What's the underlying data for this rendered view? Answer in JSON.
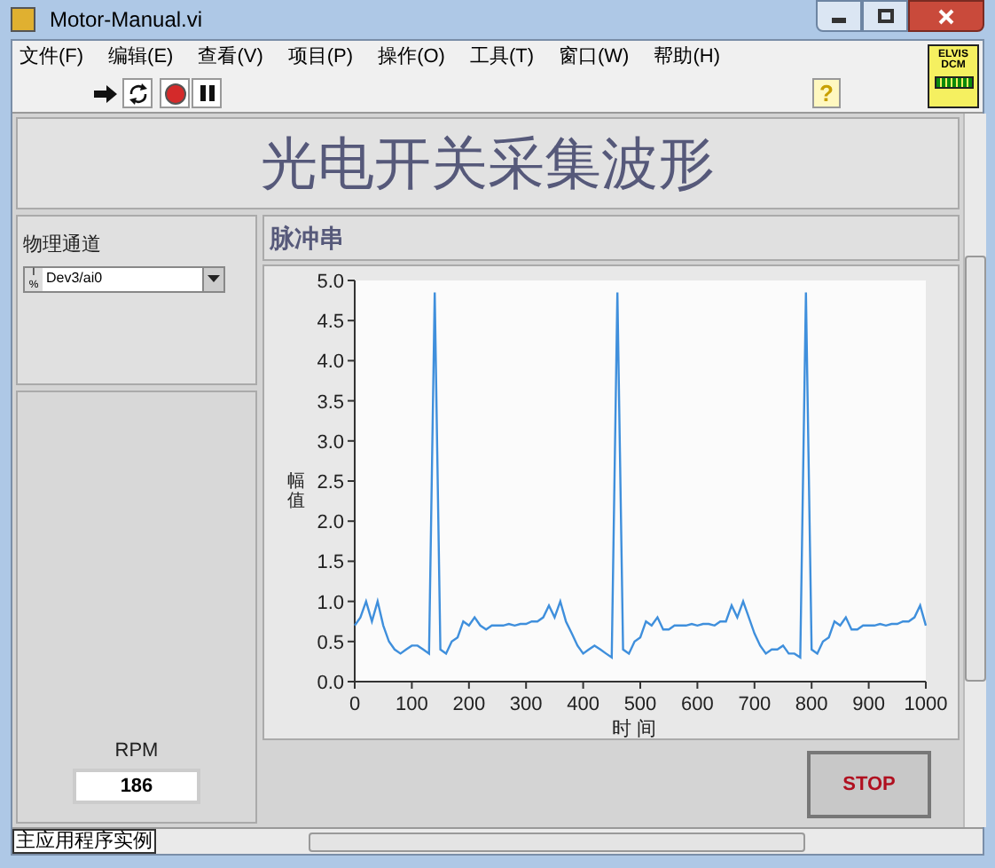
{
  "window": {
    "title": "Motor-Manual.vi"
  },
  "menu": [
    "文件(F)",
    "编辑(E)",
    "查看(V)",
    "项目(P)",
    "操作(O)",
    "工具(T)",
    "窗口(W)",
    "帮助(H)"
  ],
  "toolbar": {
    "help": "?"
  },
  "badge": {
    "line_1": "ELVIS",
    "line_2": "DCM"
  },
  "panel": {
    "title": "光电开关采集波形",
    "channel": {
      "label": "物理通道",
      "value": "Dev3/ai0",
      "prefix_1": "I",
      "prefix_2": "%"
    },
    "rpm": {
      "label": "RPM",
      "value": "186"
    },
    "graph": {
      "title": "脉冲串",
      "chart_data": {
        "type": "line",
        "xlabel": "时 间",
        "ylabel": "幅值",
        "xlim": [
          0,
          1000
        ],
        "ylim": [
          0,
          5
        ],
        "xticks": [
          0,
          100,
          200,
          300,
          400,
          500,
          600,
          700,
          800,
          900,
          1000
        ],
        "yticks": [
          {
            "value": 0,
            "label": "0.0"
          },
          {
            "value": 0.5,
            "label": "0.5"
          },
          {
            "value": 1,
            "label": "1.0"
          },
          {
            "value": 1.5,
            "label": "1.5"
          },
          {
            "value": 2,
            "label": "2.0"
          },
          {
            "value": 2.5,
            "label": "2.5"
          },
          {
            "value": 3,
            "label": "3.0"
          },
          {
            "value": 3.5,
            "label": "3.5"
          },
          {
            "value": 4,
            "label": "4.0"
          },
          {
            "value": 4.5,
            "label": "4.5"
          },
          {
            "value": 5,
            "label": "5.0"
          }
        ],
        "x": [
          0,
          10,
          20,
          30,
          40,
          50,
          60,
          70,
          80,
          90,
          100,
          110,
          120,
          130,
          140,
          150,
          160,
          170,
          180,
          190,
          200,
          210,
          220,
          230,
          240,
          250,
          260,
          270,
          280,
          290,
          300,
          310,
          320,
          330,
          340,
          350,
          360,
          370,
          380,
          390,
          400,
          410,
          420,
          430,
          440,
          450,
          460,
          470,
          480,
          490,
          500,
          510,
          520,
          530,
          540,
          550,
          560,
          570,
          580,
          590,
          600,
          610,
          620,
          630,
          640,
          650,
          660,
          670,
          680,
          690,
          700,
          710,
          720,
          730,
          740,
          750,
          760,
          770,
          780,
          790,
          800,
          810,
          820,
          830,
          840,
          850,
          860,
          870,
          880,
          890,
          900,
          910,
          920,
          930,
          940,
          950,
          960,
          970,
          980,
          990,
          1000
        ],
        "series": [
          {
            "color": "#3f8fdc",
            "values": [
              0.7,
              0.8,
              1.0,
              0.75,
              1.0,
              0.7,
              0.5,
              0.4,
              0.35,
              0.4,
              0.45,
              0.45,
              0.4,
              0.35,
              4.85,
              0.4,
              0.35,
              0.5,
              0.55,
              0.75,
              0.7,
              0.8,
              0.7,
              0.65,
              0.7,
              0.7,
              0.7,
              0.72,
              0.7,
              0.72,
              0.72,
              0.75,
              0.75,
              0.8,
              0.95,
              0.8,
              1.0,
              0.75,
              0.6,
              0.45,
              0.35,
              0.4,
              0.45,
              0.4,
              0.35,
              0.3,
              4.85,
              0.4,
              0.35,
              0.5,
              0.55,
              0.75,
              0.7,
              0.8,
              0.65,
              0.65,
              0.7,
              0.7,
              0.7,
              0.72,
              0.7,
              0.72,
              0.72,
              0.7,
              0.75,
              0.75,
              0.95,
              0.8,
              1.0,
              0.8,
              0.6,
              0.45,
              0.35,
              0.4,
              0.4,
              0.45,
              0.35,
              0.35,
              0.3,
              4.85,
              0.4,
              0.35,
              0.5,
              0.55,
              0.75,
              0.7,
              0.8,
              0.65,
              0.65,
              0.7,
              0.7,
              0.7,
              0.72,
              0.7,
              0.72,
              0.72,
              0.75,
              0.75,
              0.8,
              0.95,
              0.7
            ]
          }
        ]
      }
    },
    "stop_button": "STOP"
  },
  "status_bar": {
    "context": "主应用程序实例"
  }
}
